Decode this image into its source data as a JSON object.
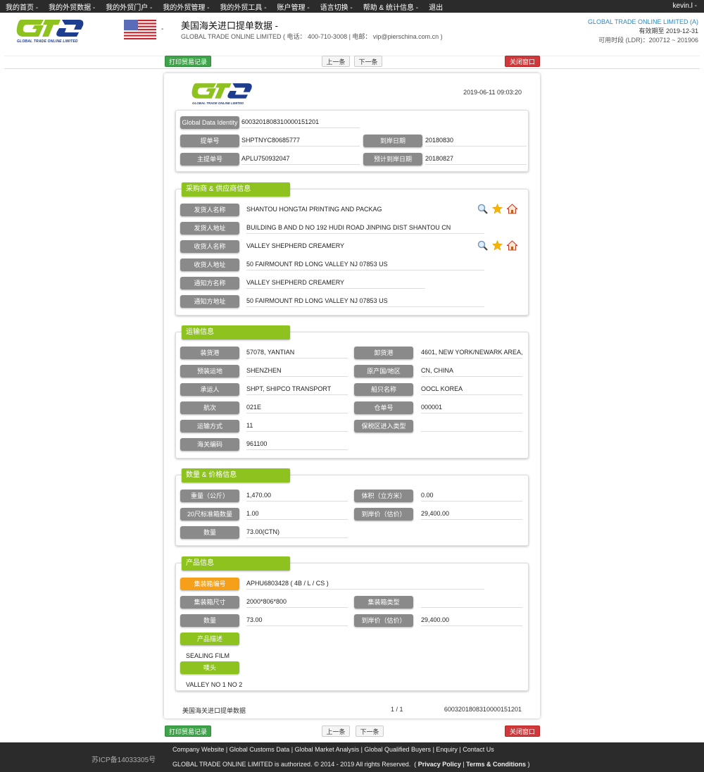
{
  "topnav": {
    "items": [
      "我的首页 -",
      "我的外贸数据 -",
      "我的外贸门户 -",
      "我的外贸管理 -",
      "我的外贸工具 -",
      "账户管理 -",
      "语言切换 -",
      "帮助 & 统计信息 -",
      "退出"
    ],
    "user": "kevin.l -"
  },
  "header": {
    "logo_text": "GLOBAL TRADE ONLINE LIMITED",
    "flag_caret": "-",
    "title": "美国海关进口提单数据  -",
    "subtitle": "GLOBAL TRADE ONLINE LIMITED ( 电话： 400-710-3008 | 电邮： vip@pierschina.com.cn )",
    "company": "GLOBAL TRADE ONLINE LIMITED (A)",
    "expiry": "有效期至 2019-12-31",
    "ldr": "可用时段 (LDR)：200712 ~ 201906"
  },
  "toolbar": {
    "print": "打印贸易记录",
    "prev": "上一条",
    "next": "下一条",
    "close": "关闭窗口"
  },
  "colors": {
    "green_button": "#3ea44a",
    "red_button": "#d0393b",
    "section_tab": "#8dc21f",
    "label_gray": "#8a8a8a",
    "label_orange": "#f6a01a",
    "company_link": "#2f87b9"
  },
  "doc": {
    "logo_text": "GLOBAL TRADE ONLINE LIMITED",
    "timestamp": "2019-06-11 09:03:20",
    "identity": {
      "gdi_label": "Global Data Identity",
      "gdi_value": "6003201808310000151201",
      "bol_label": "提单号",
      "bol_value": "SHPTNYC80685777",
      "arrival_label": "到岸日期",
      "arrival_value": "20180830",
      "master_label": "主提单号",
      "master_value": "APLU750932047",
      "est_arrival_label": "预计到岸日期",
      "est_arrival_value": "20180827"
    },
    "parties": {
      "title": "采购商 & 供应商信息",
      "rows": [
        {
          "label": "发货人名称",
          "value": "SHANTOU HONGTAI PRINTING AND PACKAG"
        },
        {
          "label": "发货人地址",
          "value": "BUILDING B AND D NO 192 HUDI ROAD JINPING DIST SHANTOU CN"
        },
        {
          "label": "收货人名称",
          "value": "VALLEY SHEPHERD CREAMERY"
        },
        {
          "label": "收货人地址",
          "value": "50 FAIRMOUNT RD LONG VALLEY NJ 07853 US"
        },
        {
          "label": "通知方名称",
          "value": "VALLEY SHEPHERD CREAMERY"
        },
        {
          "label": "通知方地址",
          "value": "50 FAIRMOUNT RD LONG VALLEY NJ 07853 US"
        }
      ],
      "icons": [
        "search-icon",
        "star-icon",
        "home-icon"
      ]
    },
    "transport": {
      "title": "运输信息",
      "left": [
        {
          "label": "装货港",
          "value": "57078, YANTIAN"
        },
        {
          "label": "预装运地",
          "value": "SHENZHEN"
        },
        {
          "label": "承运人",
          "value": "SHPT, SHIPCO TRANSPORT"
        },
        {
          "label": "航次",
          "value": "021E"
        },
        {
          "label": "运输方式",
          "value": "11"
        },
        {
          "label": "海关编码",
          "value": "961100"
        }
      ],
      "right": [
        {
          "label": "卸货港",
          "value": "4601, NEW YORK/NEWARK AREA,"
        },
        {
          "label": "原产国/地区",
          "value": "CN, CHINA"
        },
        {
          "label": "船只名称",
          "value": "OOCL KOREA"
        },
        {
          "label": "仓单号",
          "value": "000001"
        },
        {
          "label": "保税区进入类型",
          "value": ""
        }
      ]
    },
    "quantity": {
      "title": "数量 & 价格信息",
      "left": [
        {
          "label": "重量（公斤）",
          "value": "1,470.00"
        },
        {
          "label": "20尺标准箱数量",
          "value": "1.00"
        },
        {
          "label": "数量",
          "value": "73.00(CTN)"
        }
      ],
      "right": [
        {
          "label": "体积（立方米）",
          "value": "0.00"
        },
        {
          "label": "到岸价（估价）",
          "value": "29,400.00"
        }
      ]
    },
    "product": {
      "title": "产品信息",
      "container_no_label": "集装箱编号",
      "container_no_value": "APHU6803428 ( 4B / L / CS )",
      "container_size_label": "集装箱尺寸",
      "container_size_value": "2000*806*800",
      "container_type_label": "集装箱类型",
      "container_type_value": "",
      "qty_label": "数量",
      "qty_value": "73.00",
      "price_label": "到岸价（估价）",
      "price_value": "29,400.00",
      "desc_label": "产品描述",
      "desc_value": "SEALING FILM",
      "marks_label": "唛头",
      "marks_value": "VALLEY NO 1 NO 2"
    },
    "footer": {
      "title": "美国海关进口提单数据",
      "page": "1 / 1",
      "id": "6003201808310000151201"
    }
  },
  "footer": {
    "icp": "苏ICP备14033305号",
    "links": [
      "Company Website",
      "Global Customs Data",
      "Global Market Analysis",
      "Global Qualified Buyers",
      "Enquiry",
      "Contact Us"
    ],
    "copyright": "GLOBAL TRADE ONLINE LIMITED is authorized. © 2014 - 2019 All rights Reserved.",
    "privacy": "Privacy Policy",
    "terms": "Terms & Conditions"
  }
}
